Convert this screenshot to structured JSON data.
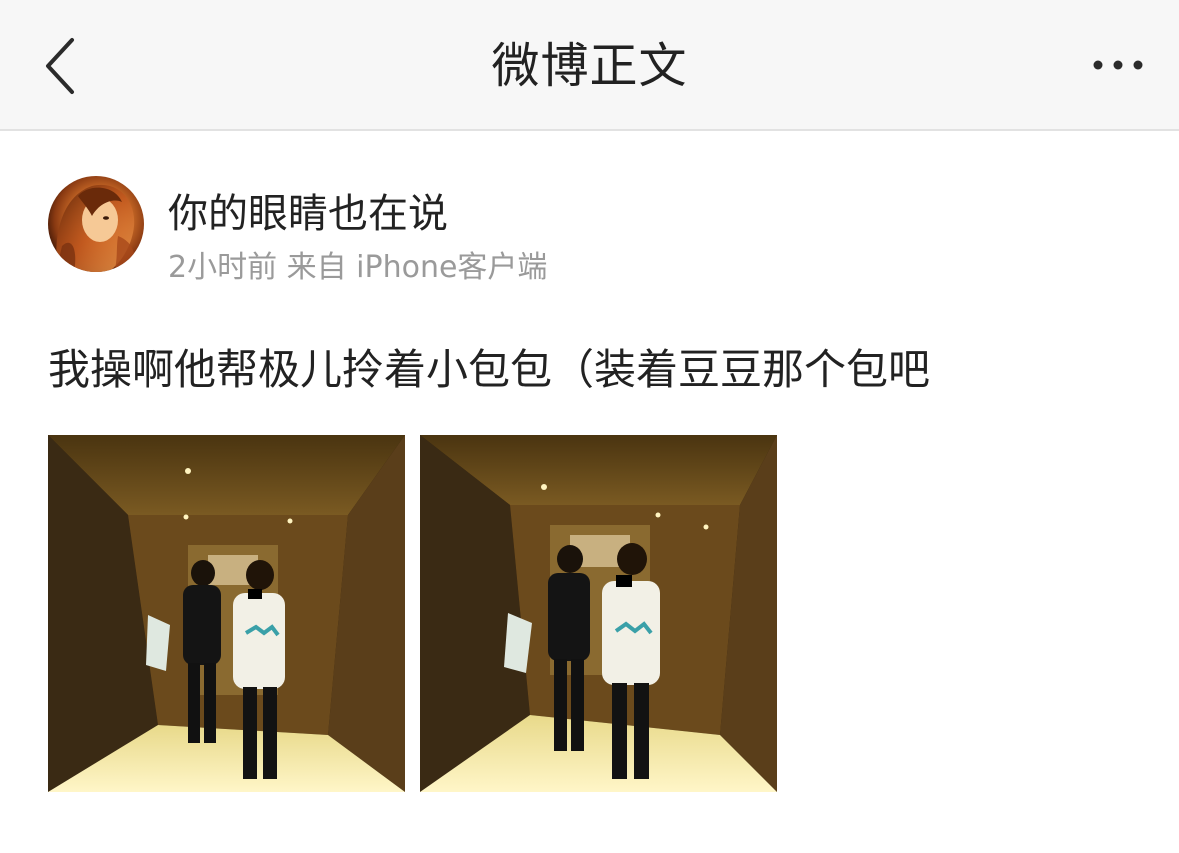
{
  "nav": {
    "title": "微博正文",
    "back_icon": "chevron-left-icon",
    "more_icon": "more-dots-icon"
  },
  "post": {
    "author": "你的眼睛也在说",
    "time": "2小时前",
    "source": "来自 iPhone客户端",
    "meta": "2小时前 来自 iPhone客户端",
    "text": "我操啊他帮极儿拎着小包包（装着豆豆那个包吧",
    "images": [
      {
        "description": "two people walking in a hotel hallway taking a mirror selfie"
      },
      {
        "description": "two people walking in a hotel hallway taking a mirror selfie"
      }
    ]
  },
  "colors": {
    "nav_background": "#f7f7f7",
    "text_primary": "#222222",
    "text_secondary": "#9a9a9a"
  }
}
